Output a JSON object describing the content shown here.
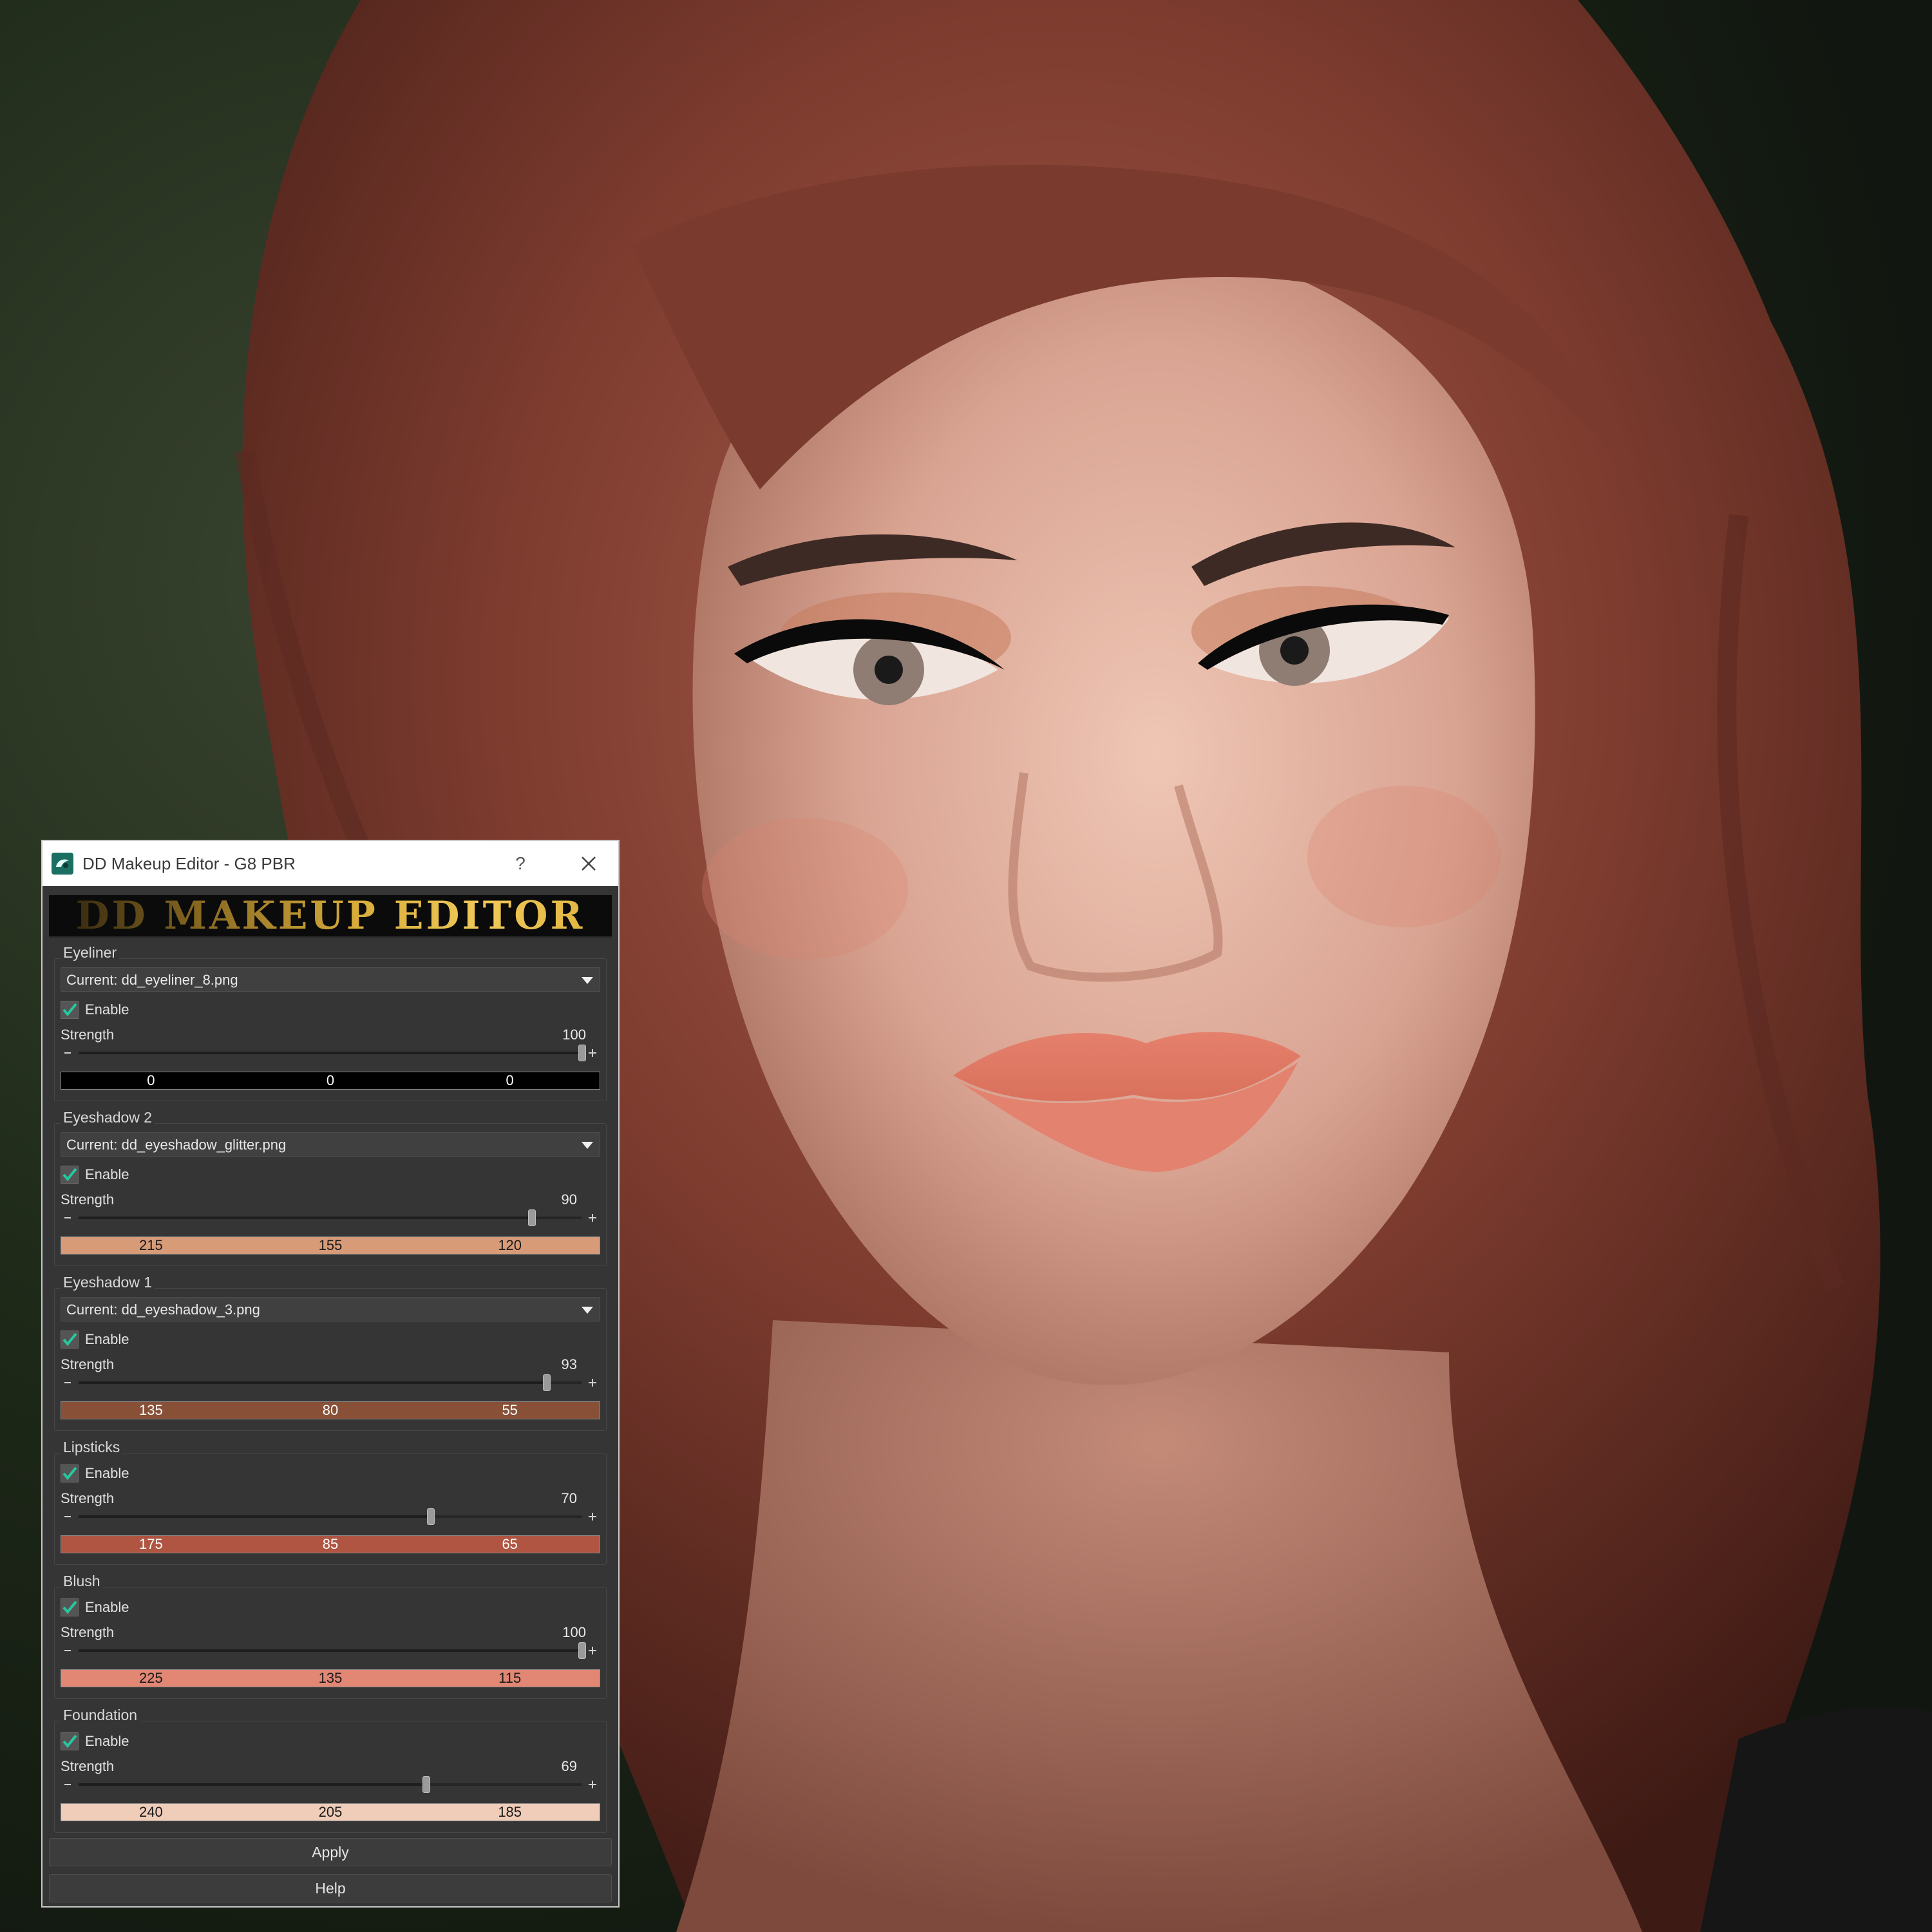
{
  "window": {
    "title": "DD Makeup Editor - G8 PBR",
    "help_glyph": "?",
    "banner": "DD MAKEUP EDITOR"
  },
  "labels": {
    "enable": "Enable",
    "strength": "Strength"
  },
  "sections": {
    "eyeliner": {
      "title": "Eyeliner",
      "dropdown": "Current: dd_eyeliner_8.png",
      "enabled": true,
      "strength": 100,
      "rgb": {
        "r": "0",
        "g": "0",
        "b": "0"
      },
      "color": "#000000",
      "text_color": "#ffffff"
    },
    "eyeshadow2": {
      "title": "Eyeshadow 2",
      "dropdown": "Current: dd_eyeshadow_glitter.png",
      "enabled": true,
      "strength": 90,
      "rgb": {
        "r": "215",
        "g": "155",
        "b": "120"
      },
      "color": "#d79b78",
      "text_color": "#1a1a1a"
    },
    "eyeshadow1": {
      "title": "Eyeshadow 1",
      "dropdown": "Current: dd_eyeshadow_3.png",
      "enabled": true,
      "strength": 93,
      "rgb": {
        "r": "135",
        "g": "80",
        "b": "55"
      },
      "color": "#875037",
      "text_color": "#ffffff"
    },
    "lipsticks": {
      "title": "Lipsticks",
      "enabled": true,
      "strength": 70,
      "rgb": {
        "r": "175",
        "g": "85",
        "b": "65"
      },
      "color": "#af5541",
      "text_color": "#ffffff"
    },
    "blush": {
      "title": "Blush",
      "enabled": true,
      "strength": 100,
      "rgb": {
        "r": "225",
        "g": "135",
        "b": "115"
      },
      "color": "#e18773",
      "text_color": "#1a1a1a"
    },
    "foundation": {
      "title": "Foundation",
      "enabled": true,
      "strength": 69,
      "rgb": {
        "r": "240",
        "g": "205",
        "b": "185"
      },
      "color": "#f0cdb9",
      "text_color": "#1a1a1a"
    }
  },
  "buttons": {
    "apply": "Apply",
    "help": "Help"
  },
  "colors": {
    "accent_check": "#27c7a0",
    "dialog_bg": "#353535"
  }
}
